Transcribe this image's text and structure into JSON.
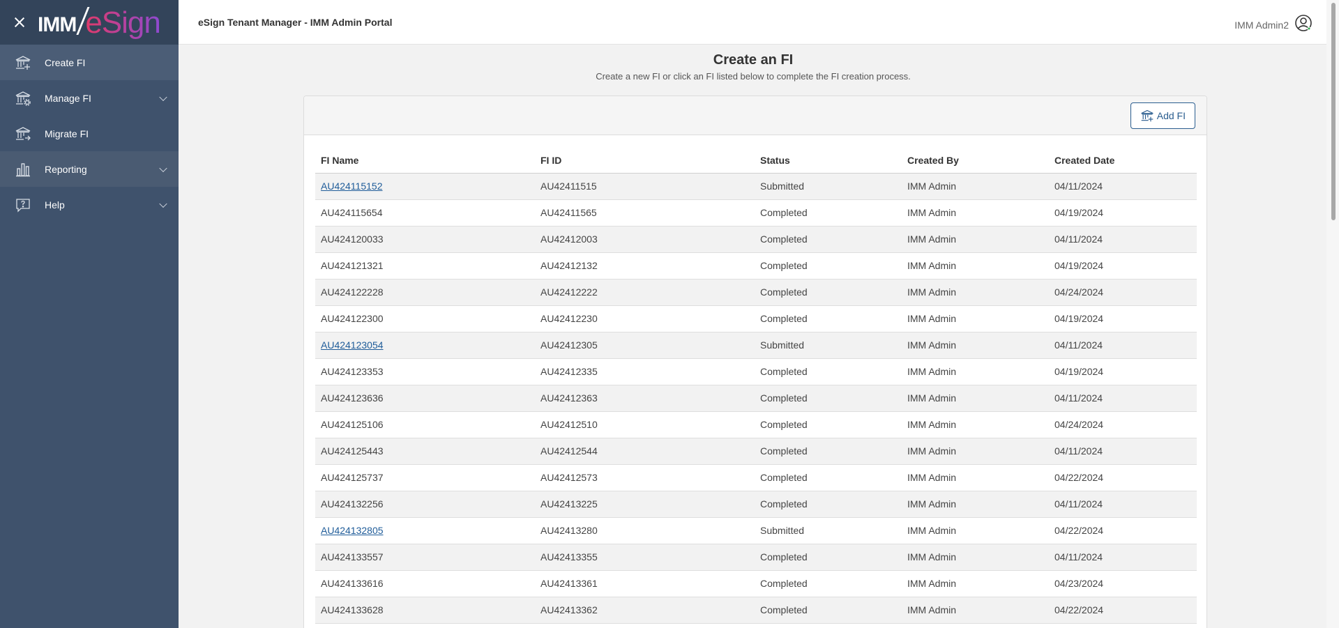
{
  "brand": {
    "imm": "IMM",
    "esign": "eSign"
  },
  "sidebar": {
    "items": [
      {
        "label": "Create FI",
        "icon": "bank-plus-icon",
        "active": true,
        "expandable": false
      },
      {
        "label": "Manage FI",
        "icon": "bank-gear-icon",
        "active": false,
        "expandable": true
      },
      {
        "label": "Migrate FI",
        "icon": "bank-arrow-icon",
        "active": false,
        "expandable": false
      },
      {
        "label": "Reporting",
        "icon": "bar-chart-icon",
        "active": false,
        "expandable": true
      },
      {
        "label": "Help",
        "icon": "help-bubble-icon",
        "active": false,
        "expandable": true
      }
    ]
  },
  "header": {
    "title": "eSign Tenant Manager - IMM Admin Portal",
    "user_name": "IMM Admin2"
  },
  "main": {
    "title": "Create an FI",
    "subtitle": "Create a new FI or click an FI listed below to complete the FI creation process.",
    "add_button_label": "Add FI"
  },
  "table": {
    "columns": [
      "FI Name",
      "FI ID",
      "Status",
      "Created By",
      "Created Date"
    ],
    "rows": [
      {
        "name": "AU424115152",
        "id": "AU42411515",
        "status": "Submitted",
        "created_by": "IMM Admin",
        "date": "04/11/2024",
        "link": true
      },
      {
        "name": "AU424115654",
        "id": "AU42411565",
        "status": "Completed",
        "created_by": "IMM Admin",
        "date": "04/19/2024",
        "link": false
      },
      {
        "name": "AU424120033",
        "id": "AU42412003",
        "status": "Completed",
        "created_by": "IMM Admin",
        "date": "04/11/2024",
        "link": false
      },
      {
        "name": "AU424121321",
        "id": "AU42412132",
        "status": "Completed",
        "created_by": "IMM Admin",
        "date": "04/19/2024",
        "link": false
      },
      {
        "name": "AU424122228",
        "id": "AU42412222",
        "status": "Completed",
        "created_by": "IMM Admin",
        "date": "04/24/2024",
        "link": false
      },
      {
        "name": "AU424122300",
        "id": "AU42412230",
        "status": "Completed",
        "created_by": "IMM Admin",
        "date": "04/19/2024",
        "link": false
      },
      {
        "name": "AU424123054",
        "id": "AU42412305",
        "status": "Submitted",
        "created_by": "IMM Admin",
        "date": "04/11/2024",
        "link": true
      },
      {
        "name": "AU424123353",
        "id": "AU42412335",
        "status": "Completed",
        "created_by": "IMM Admin",
        "date": "04/19/2024",
        "link": false
      },
      {
        "name": "AU424123636",
        "id": "AU42412363",
        "status": "Completed",
        "created_by": "IMM Admin",
        "date": "04/11/2024",
        "link": false
      },
      {
        "name": "AU424125106",
        "id": "AU42412510",
        "status": "Completed",
        "created_by": "IMM Admin",
        "date": "04/24/2024",
        "link": false
      },
      {
        "name": "AU424125443",
        "id": "AU42412544",
        "status": "Completed",
        "created_by": "IMM Admin",
        "date": "04/11/2024",
        "link": false
      },
      {
        "name": "AU424125737",
        "id": "AU42412573",
        "status": "Completed",
        "created_by": "IMM Admin",
        "date": "04/22/2024",
        "link": false
      },
      {
        "name": "AU424132256",
        "id": "AU42413225",
        "status": "Completed",
        "created_by": "IMM Admin",
        "date": "04/11/2024",
        "link": false
      },
      {
        "name": "AU424132805",
        "id": "AU42413280",
        "status": "Submitted",
        "created_by": "IMM Admin",
        "date": "04/22/2024",
        "link": true
      },
      {
        "name": "AU424133557",
        "id": "AU42413355",
        "status": "Completed",
        "created_by": "IMM Admin",
        "date": "04/11/2024",
        "link": false
      },
      {
        "name": "AU424133616",
        "id": "AU42413361",
        "status": "Completed",
        "created_by": "IMM Admin",
        "date": "04/23/2024",
        "link": false
      },
      {
        "name": "AU424133628",
        "id": "AU42413362",
        "status": "Completed",
        "created_by": "IMM Admin",
        "date": "04/22/2024",
        "link": false
      }
    ]
  },
  "colors": {
    "sidebar_bg": "#3f526c",
    "sidebar_head_bg": "#33445a",
    "link": "#1f5c99",
    "accent_border": "#2a5d8f",
    "brand_gradient_start": "#e03a6a",
    "brand_gradient_end": "#8e4ad0"
  }
}
